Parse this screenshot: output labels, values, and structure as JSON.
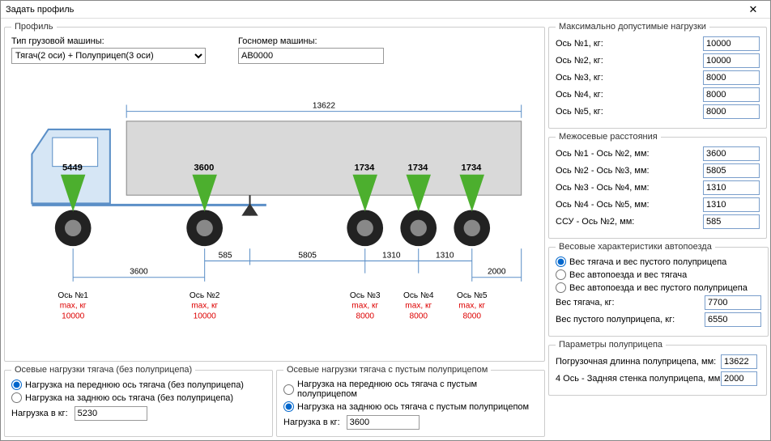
{
  "window": {
    "title": "Задать профиль",
    "close": "✕"
  },
  "profile": {
    "legend": "Профиль",
    "type_label": "Тип грузовой машины:",
    "type_value": "Тягач(2 оси) + Полуприцеп(3 оси)",
    "plate_label": "Госномер машины:",
    "plate_value": "AB0000"
  },
  "diagram": {
    "total_length": "13622",
    "forces": [
      "5449",
      "3600",
      "1734",
      "1734",
      "1734"
    ],
    "dims": {
      "d12": "3600",
      "ssu": "585",
      "d23": "5805",
      "d34": "1310",
      "d45": "1310",
      "tail": "2000"
    },
    "axle_label": "Ось №",
    "max_label": "max, кг",
    "axle_max": [
      "10000",
      "10000",
      "8000",
      "8000",
      "8000"
    ]
  },
  "maxloads": {
    "legend": "Максимально допустимые нагрузки",
    "rows": [
      {
        "label": "Ось №1, кг:",
        "value": "10000"
      },
      {
        "label": "Ось №2, кг:",
        "value": "10000"
      },
      {
        "label": "Ось №3, кг:",
        "value": "8000"
      },
      {
        "label": "Ось №4, кг:",
        "value": "8000"
      },
      {
        "label": "Ось №5, кг:",
        "value": "8000"
      }
    ]
  },
  "dist": {
    "legend": "Межосевые расстояния",
    "rows": [
      {
        "label": "Ось №1 - Ось №2, мм:",
        "value": "3600"
      },
      {
        "label": "Ось №2 - Ось №3, мм:",
        "value": "5805"
      },
      {
        "label": "Ось №3 - Ось №4, мм:",
        "value": "1310"
      },
      {
        "label": "Ось №4 - Ось №5, мм:",
        "value": "1310"
      },
      {
        "label": "ССУ - Ось №2, мм:",
        "value": "585"
      }
    ]
  },
  "weights": {
    "legend": "Весовые характеристики автопоезда",
    "opt1": "Вес тягача и вес пустого полуприцепа",
    "opt2": "Вес автопоезда и вес тягача",
    "opt3": "Вес автопоезда и вес пустого полуприцепа",
    "tractor_label": "Вес тягача, кг:",
    "tractor_value": "7700",
    "trailer_label": "Вес пустого полуприцепа, кг:",
    "trailer_value": "6550"
  },
  "trailer_params": {
    "legend": "Параметры полуприцепа",
    "len_label": "Погрузочная длинна полуприцепа, мм:",
    "len_value": "13622",
    "rear_label": "4 Ось - Задняя стенка полуприцепа, мм:",
    "rear_value": "2000"
  },
  "axle_tractor": {
    "legend": "Осевые нагрузки тягача (без полуприцепа)",
    "opt1": "Нагрузка на переднюю ось тягача (без полуприцепа)",
    "opt2": "Нагрузка на заднюю ось тягача (без полуприцепа)",
    "load_label": "Нагрузка в кг:",
    "load_value": "5230"
  },
  "axle_empty": {
    "legend": "Осевые нагрузки тягача с пустым полуприцепом",
    "opt1": "Нагрузка на переднюю ось тягача с пустым полуприцепом",
    "opt2": "Нагрузка на заднюю ось тягача с пустым полуприцепом",
    "load_label": "Нагрузка в кг:",
    "load_value": "3600"
  }
}
